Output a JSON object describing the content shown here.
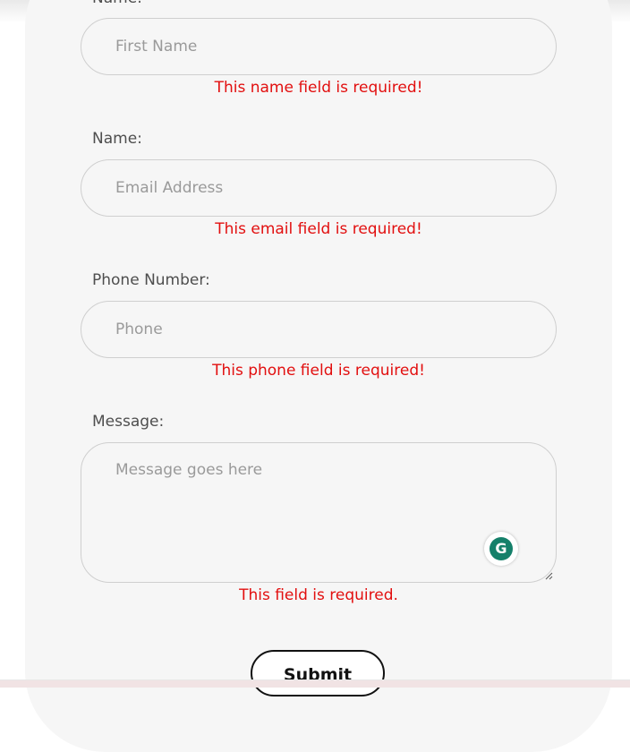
{
  "form": {
    "name_label_partial": "Name:",
    "first_name_placeholder": "First Name",
    "first_name_error": "This name field is required!",
    "email_label": "Name:",
    "email_placeholder": "Email Address",
    "email_error": "This email field is required!",
    "phone_label": "Phone Number:",
    "phone_placeholder": "Phone",
    "phone_error": "This phone field is required!",
    "message_label": "Message:",
    "message_placeholder": "Message goes here",
    "message_error": "This field is required.",
    "submit_label": "Submit"
  },
  "grammarly": {
    "glyph": "G",
    "icon": "grammarly-icon"
  },
  "colors": {
    "error": "#e20f0f",
    "card_background": "#f6f6f6",
    "border": "#cfcfcf",
    "grammarly_green": "#15806a"
  }
}
